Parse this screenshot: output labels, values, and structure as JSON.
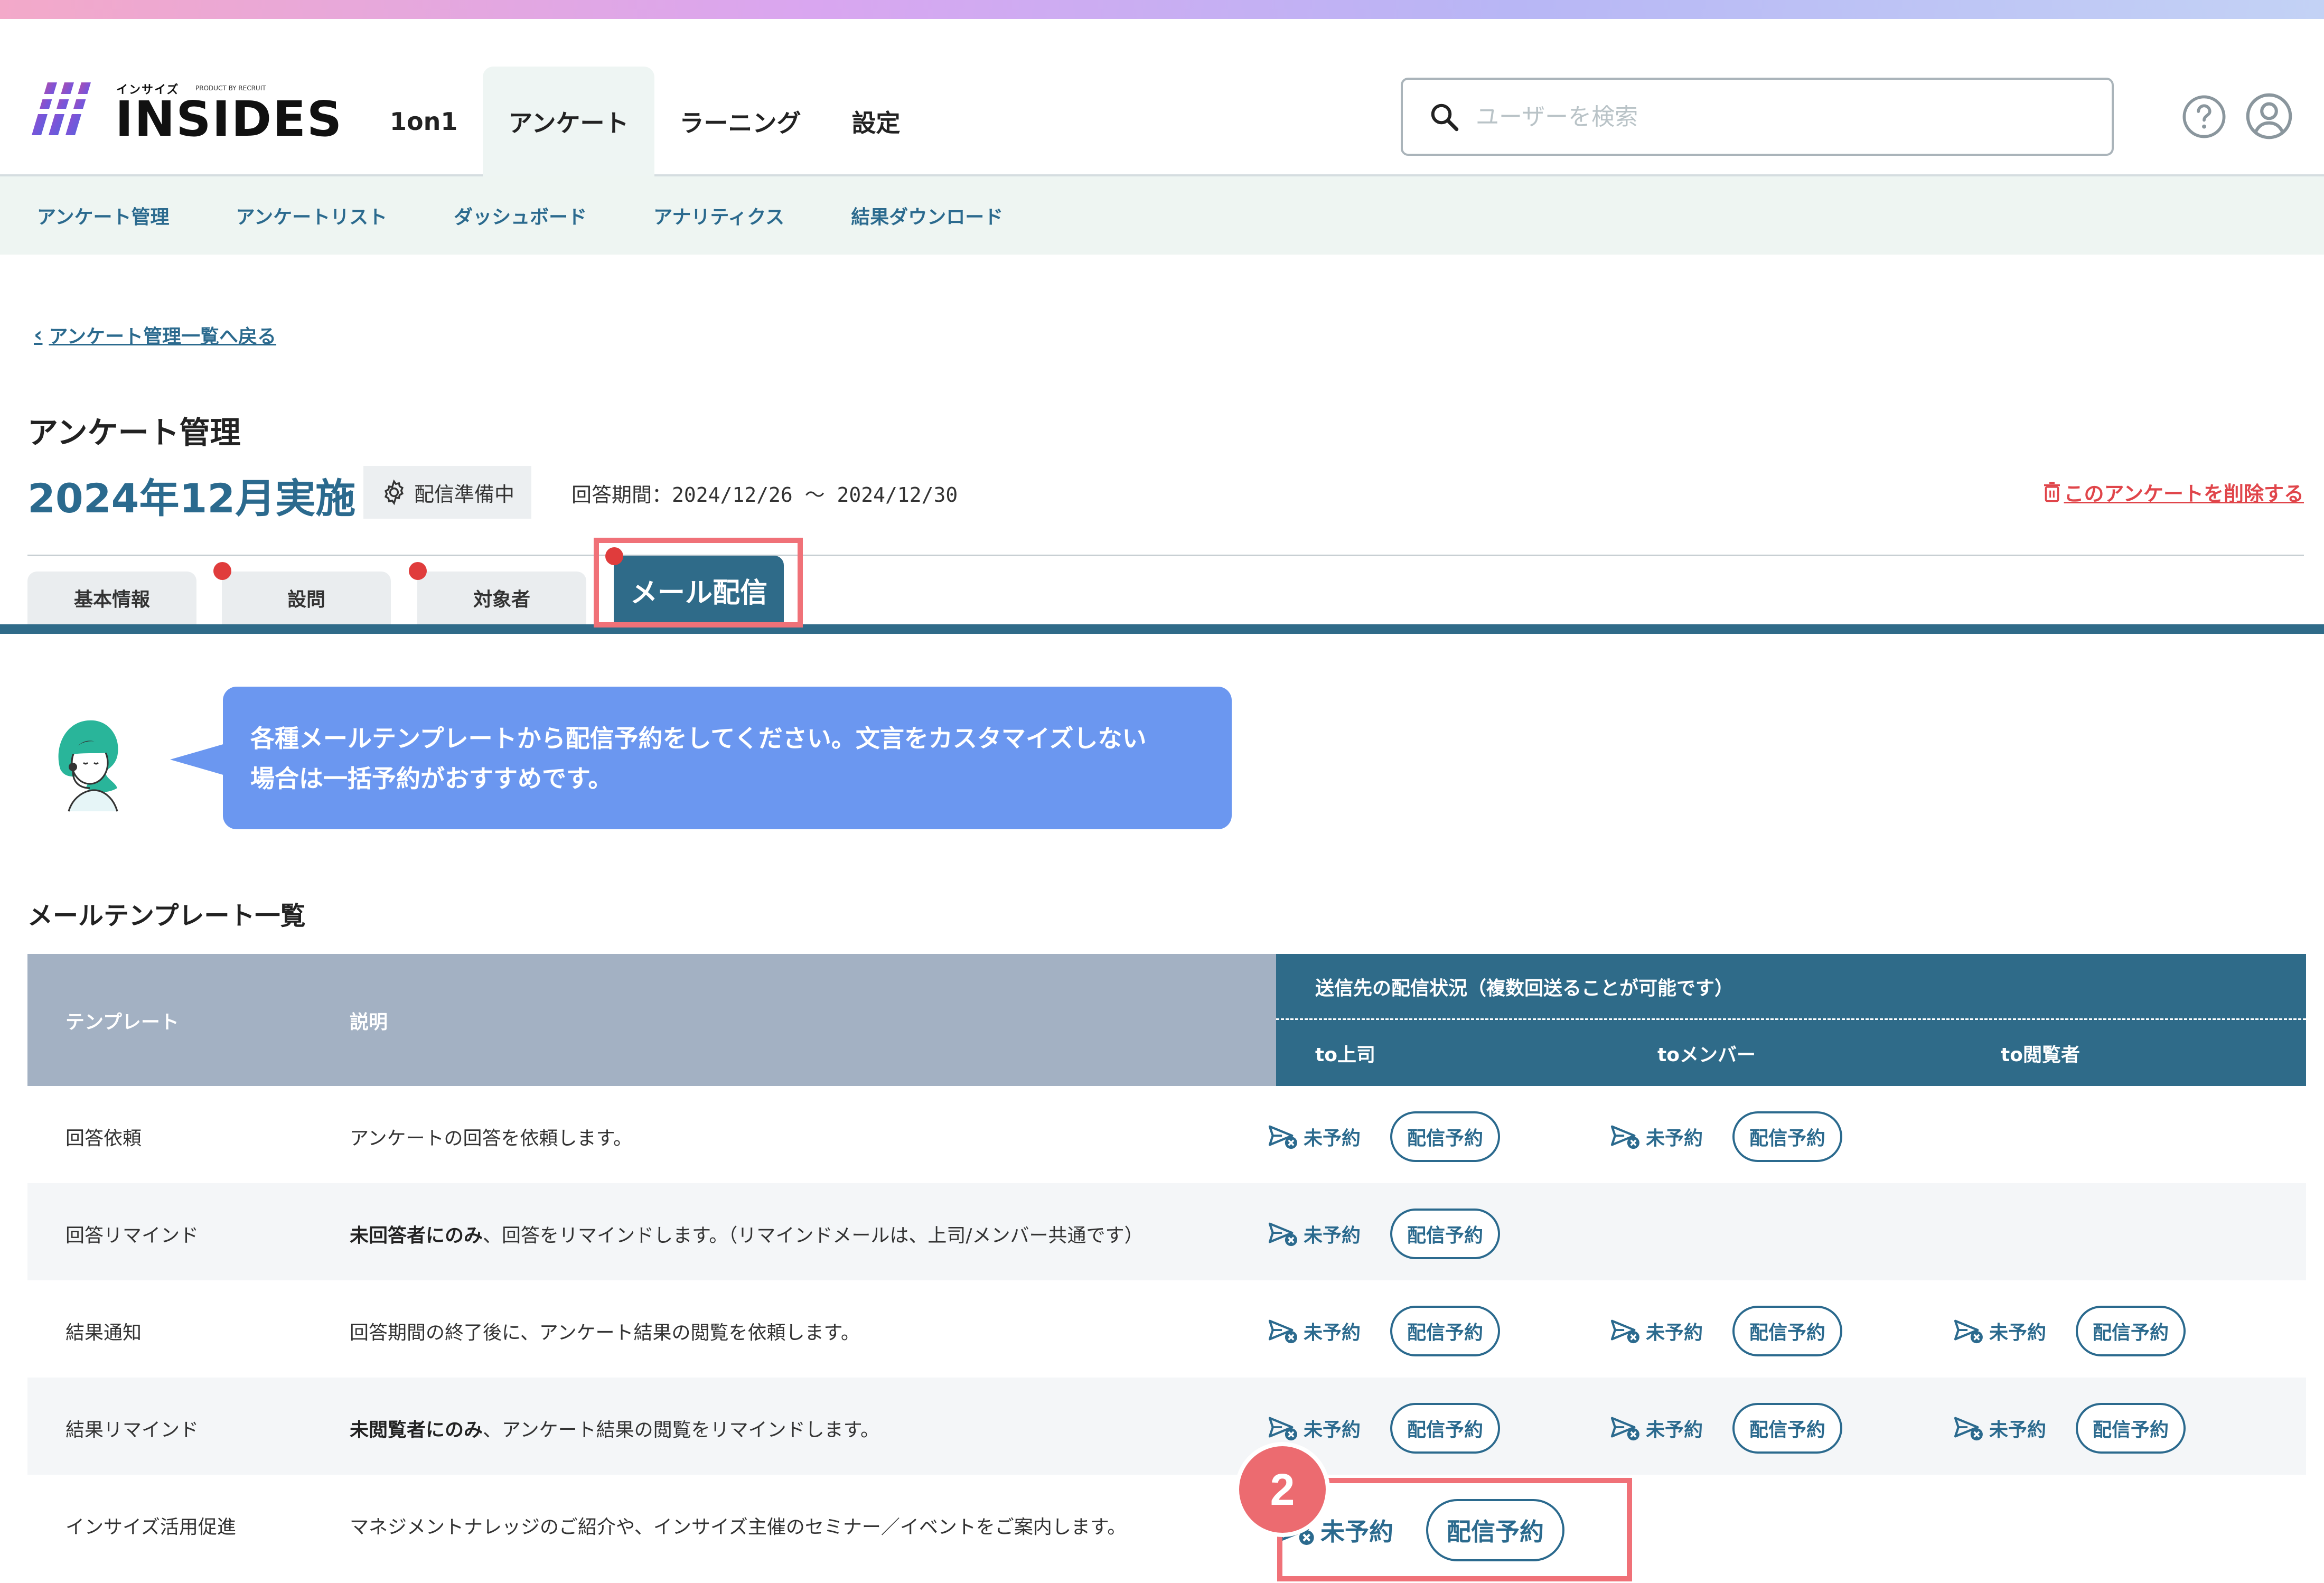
{
  "brand": {
    "logo_sub": "インサイズ",
    "logo_product": "PRODUCT BY RECRUIT",
    "logo_text": "INSIDES"
  },
  "nav": [
    {
      "label": "1on1"
    },
    {
      "label": "アンケート",
      "active": true
    },
    {
      "label": "ラーニング"
    },
    {
      "label": "設定"
    }
  ],
  "search": {
    "placeholder": "ユーザーを検索"
  },
  "subnav": [
    "アンケート管理",
    "アンケートリスト",
    "ダッシュボード",
    "アナリティクス",
    "結果ダウンロード"
  ],
  "back_link": "アンケート管理一覧へ戻る",
  "page_title": "アンケート管理",
  "survey_name": "2024年12月実施",
  "status_badge": "配信準備中",
  "period": "回答期間：2024/12/26 〜 2024/12/30",
  "delete_link": "このアンケートを削除する",
  "tabs": [
    {
      "label": "基本情報"
    },
    {
      "label": "設問",
      "dot": true
    },
    {
      "label": "対象者",
      "dot": true
    },
    {
      "label": "メール配信",
      "active": true,
      "dot": true
    }
  ],
  "guide_message": "各種メールテンプレートから配信予約をしてください。文言をカスタマイズしない場合は一括予約がおすすめです。",
  "guide_line1": "各種メールテンプレートから配信予約をしてください。文言をカスタマイズしない",
  "guide_line2": "場合は一括予約がおすすめです。",
  "section_title": "メールテンプレート一覧",
  "table": {
    "col_template": "テンプレート",
    "col_desc": "説明",
    "col_delivery_title": "送信先の配信状況（複数回送ることが可能です）",
    "recipient_cols": [
      "to上司",
      "toメンバー",
      "to閲覧者"
    ],
    "status_text": "未予約",
    "button_text": "配信予約",
    "rows": [
      {
        "template": "回答依頼",
        "desc_bold": "",
        "desc": "アンケートの回答を依頼します。",
        "recipients": [
          true,
          true,
          false
        ]
      },
      {
        "template": "回答リマインド",
        "desc_bold": "未回答者にのみ",
        "desc": "、回答をリマインドします。（リマインドメールは、上司/メンバー共通です）",
        "recipients": [
          true,
          false,
          false
        ]
      },
      {
        "template": "結果通知",
        "desc_bold": "",
        "desc": "回答期間の終了後に、アンケート結果の閲覧を依頼します。",
        "recipients": [
          true,
          true,
          true
        ]
      },
      {
        "template": "結果リマインド",
        "desc_bold": "未閲覧者にのみ",
        "desc": "、アンケート結果の閲覧をリマインドします。",
        "recipients": [
          true,
          true,
          true
        ]
      },
      {
        "template": "インサイズ活用促進",
        "desc_bold": "",
        "desc": "マネジメントナレッジのご紹介や、インサイズ主催のセミナー／イベントをご案内します。",
        "recipients": [
          true,
          false,
          false
        ]
      }
    ]
  },
  "step_badge": "2",
  "colors": {
    "primary": "#2f6b89",
    "accent_red": "#e03c3c",
    "highlight": "#f07178",
    "bubble": "#6b97f0"
  }
}
